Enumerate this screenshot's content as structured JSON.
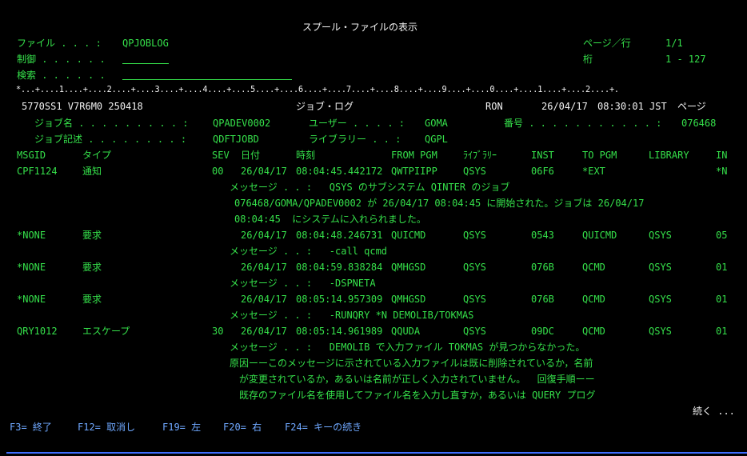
{
  "title": "スプール・ファイルの表示",
  "header": {
    "file_label": "ファイル . . . :",
    "file_value": "QPJOBLOG",
    "control_label": "制御 . . . . . .",
    "control_value": "",
    "search_label": "検索 . . . . . .",
    "search_value": "",
    "page_row_label": "ページ／行",
    "page_row_value": "1/1",
    "column_label": "桁",
    "column_value": "1 - 127"
  },
  "ruler": "*...+....1....+....2....+....3....+....4....+....5....+....6....+....7....+....8....+....9....+....0....+....1....+....2....+.",
  "job": {
    "system": "5770SS1 V7R6M0 250418",
    "log_title": "ジョブ・ログ",
    "sysname": "RON",
    "date": "26/04/17",
    "time": "08:30:01 JST",
    "page_label": "ページ",
    "name_label": "ジョブ名 . . . . . . . . . :",
    "name_value": "QPADEV0002",
    "user_label": "ユーザー . . . . :",
    "user_value": "GOMA",
    "number_label": "番号 . . . . . . . . . . . :",
    "number_value": "076468",
    "desc_label": "ジョブ記述 . . . . . . . . :",
    "desc_value": "QDFTJOBD",
    "lib_label": "ライブラリー . . :",
    "lib_value": "QGPL"
  },
  "columns": [
    "MSGID",
    "タイプ",
    "SEV",
    "日付",
    "時刻",
    "FROM PGM",
    "ﾗｲﾌﾞﾗﾘｰ",
    "INST",
    "TO PGM",
    "LIBRARY",
    "IN"
  ],
  "rows": [
    {
      "msgid": "CPF1124",
      "type": "通知",
      "sev": "00",
      "date": "26/04/17",
      "time": "08:04:45.442172",
      "frompgm": "QWTPIIPP",
      "fromlib": "QSYS",
      "inst": "06F6",
      "topgm": "*EXT",
      "library": "",
      "inst2": "*N"
    },
    {
      "msgid": "*NONE",
      "type": "要求",
      "sev": "",
      "date": "26/04/17",
      "time": "08:04:48.246731",
      "frompgm": "QUICMD",
      "fromlib": "QSYS",
      "inst": "0543",
      "topgm": "QUICMD",
      "library": "QSYS",
      "inst2": "05"
    },
    {
      "msgid": "*NONE",
      "type": "要求",
      "sev": "",
      "date": "26/04/17",
      "time": "08:04:59.838284",
      "frompgm": "QMHGSD",
      "fromlib": "QSYS",
      "inst": "076B",
      "topgm": "QCMD",
      "library": "QSYS",
      "inst2": "01"
    },
    {
      "msgid": "*NONE",
      "type": "要求",
      "sev": "",
      "date": "26/04/17",
      "time": "08:05:14.957309",
      "frompgm": "QMHGSD",
      "fromlib": "QSYS",
      "inst": "076B",
      "topgm": "QCMD",
      "library": "QSYS",
      "inst2": "01"
    },
    {
      "msgid": "QRY1012",
      "type": "エスケープ",
      "sev": "30",
      "date": "26/04/17",
      "time": "08:05:14.961989",
      "frompgm": "QQUDA",
      "fromlib": "QSYS",
      "inst": "09DC",
      "topgm": "QCMD",
      "library": "QSYS",
      "inst2": "01"
    }
  ],
  "messages": {
    "m1_l1": "メッセージ . . :   QSYS のサブシステム QINTER のジョブ",
    "m1_l2": "076468/GOMA/QPADEV0002 が 26/04/17 08:04:45 に開始された。ジョブは 26/04/17",
    "m1_l3": "08:04:45  にシステムに入れられました。",
    "m2": "メッセージ . . :   -call qcmd",
    "m3": "メッセージ . . :   -DSPNETA",
    "m4": "メッセージ . . :   -RUNQRY *N DEMOLIB/TOKMAS",
    "m5_l1": "メッセージ . . :   DEMOLIB で入力ファイル TOKMAS が見つからなかった。",
    "m5_l2": "原因ーーこのメッセージに示されている入力ファイルは既に削除されているか，名前",
    "m5_l3": "が変更されているか，あるいは名前が正しく入力されていません。  回復手順ーー",
    "m5_l4": "既存のファイル名を使用してファイル名を入力し直すか，あるいは QUERY プログ"
  },
  "more": "続く ...",
  "fkeys": [
    "F3= 終了",
    "F12= 取消し",
    "F19= 左",
    "F20= 右",
    "F24= キーの続き"
  ]
}
